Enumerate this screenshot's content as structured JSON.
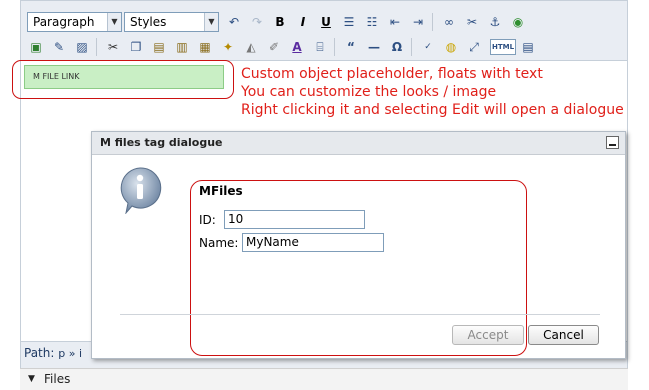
{
  "toolbar": {
    "format_select": "Paragraph",
    "styles_select": "Styles",
    "row1_icons": [
      "undo-icon",
      "redo-icon",
      "bold-icon",
      "italic-icon",
      "underline-icon",
      "bullet-list-icon",
      "numbered-list-icon",
      "outdent-icon",
      "indent-icon",
      "link-icon",
      "unlink-icon",
      "anchor-icon",
      "image-globe-icon"
    ],
    "bold_label": "B",
    "italic_label": "I",
    "underline_label": "U",
    "row2_icons": [
      "insert-image-icon",
      "edit-icon",
      "picture-icon",
      "cut-icon",
      "copy-icon",
      "paste-icon",
      "paste-text-icon",
      "paste-word-icon",
      "cleanup-icon",
      "eraser-icon",
      "remove-format-icon",
      "text-color-icon",
      "template-icon",
      "blockquote-icon",
      "horizontal-rule-icon",
      "special-char-icon",
      "spellcheck-icon",
      "comment-icon",
      "fullscreen-icon",
      "html-icon",
      "source-icon"
    ],
    "quote_label": "“",
    "hr_label": "—",
    "omega_label": "Ω",
    "html_label": "HTML"
  },
  "content": {
    "placeholder_label": "M FILE LINK"
  },
  "annotations": [
    "Custom object placeholder, floats with text",
    "You can customize the looks / image",
    "Right clicking it and selecting Edit will open a dialogue"
  ],
  "status": {
    "path_label": "Path:",
    "path_value": "p » i"
  },
  "dialog": {
    "title": "M files tag dialogue",
    "section_title": "MFiles",
    "id_label": "ID:",
    "id_value": "10",
    "name_label": "Name:",
    "name_value": "MyName",
    "accept_label": "Accept",
    "cancel_label": "Cancel"
  },
  "files_panel": {
    "label": "Files"
  },
  "colors": {
    "annotation_red": "#e0201a",
    "placeholder_green": "#c9efc5",
    "toolbar_bg": "#e9edf3"
  }
}
